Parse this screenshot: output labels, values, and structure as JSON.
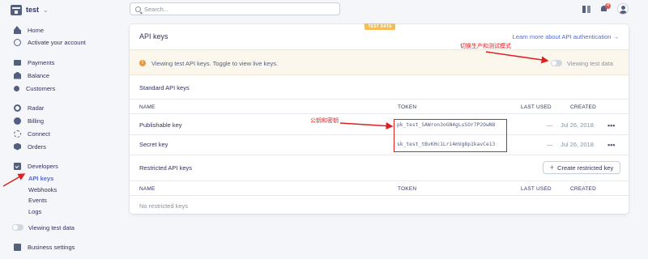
{
  "brand": {
    "name": "test",
    "caret": "⌄"
  },
  "search": {
    "placeholder": "Search..."
  },
  "notifications": {
    "count": "4"
  },
  "sidebar": {
    "home": "Home",
    "activate": "Activate your account",
    "payments": "Payments",
    "balance": "Balance",
    "customers": "Customers",
    "radar": "Radar",
    "billing": "Billing",
    "connect": "Connect",
    "orders": "Orders",
    "developers": "Developers",
    "api_keys": "API keys",
    "webhooks": "Webhooks",
    "events": "Events",
    "logs": "Logs",
    "viewing_test": "Viewing test data",
    "business_settings": "Business settings"
  },
  "card": {
    "badge": "TEST DATA",
    "title": "API keys",
    "learn_link": "Learn more about API authentication →",
    "banner_text": "Viewing test API keys. Toggle to view live keys.",
    "toggle_label": "Viewing test data"
  },
  "standard": {
    "title": "Standard API keys",
    "columns": {
      "name": "NAME",
      "token": "TOKEN",
      "last_used": "LAST USED",
      "created": "CREATED"
    },
    "rows": [
      {
        "name": "Publishable key",
        "token": "pk_test_SAWron3oGN4gLsSOr7P2OwN8",
        "last_used": "—",
        "created": "Jul 26, 2018",
        "more": "•••"
      },
      {
        "name": "Secret key",
        "token": "sk_test_tBvKHc1Lri4mVg8p1kavCe13",
        "last_used": "—",
        "created": "Jul 26, 2018",
        "more": "•••"
      }
    ]
  },
  "restricted": {
    "title": "Restricted API keys",
    "create_button": "Create restricted key",
    "columns": {
      "name": "NAME",
      "token": "TOKEN",
      "last_used": "LAST USED",
      "created": "CREATED"
    },
    "empty": "No restricted keys"
  },
  "annotations": {
    "toggle_note": "切换生产和测试模式",
    "keys_note": "公钥和密钥"
  },
  "colors": {
    "accent": "#556cd6",
    "annotation": "#e02020",
    "badge": "#f5be58",
    "warning": "#e5993e"
  }
}
